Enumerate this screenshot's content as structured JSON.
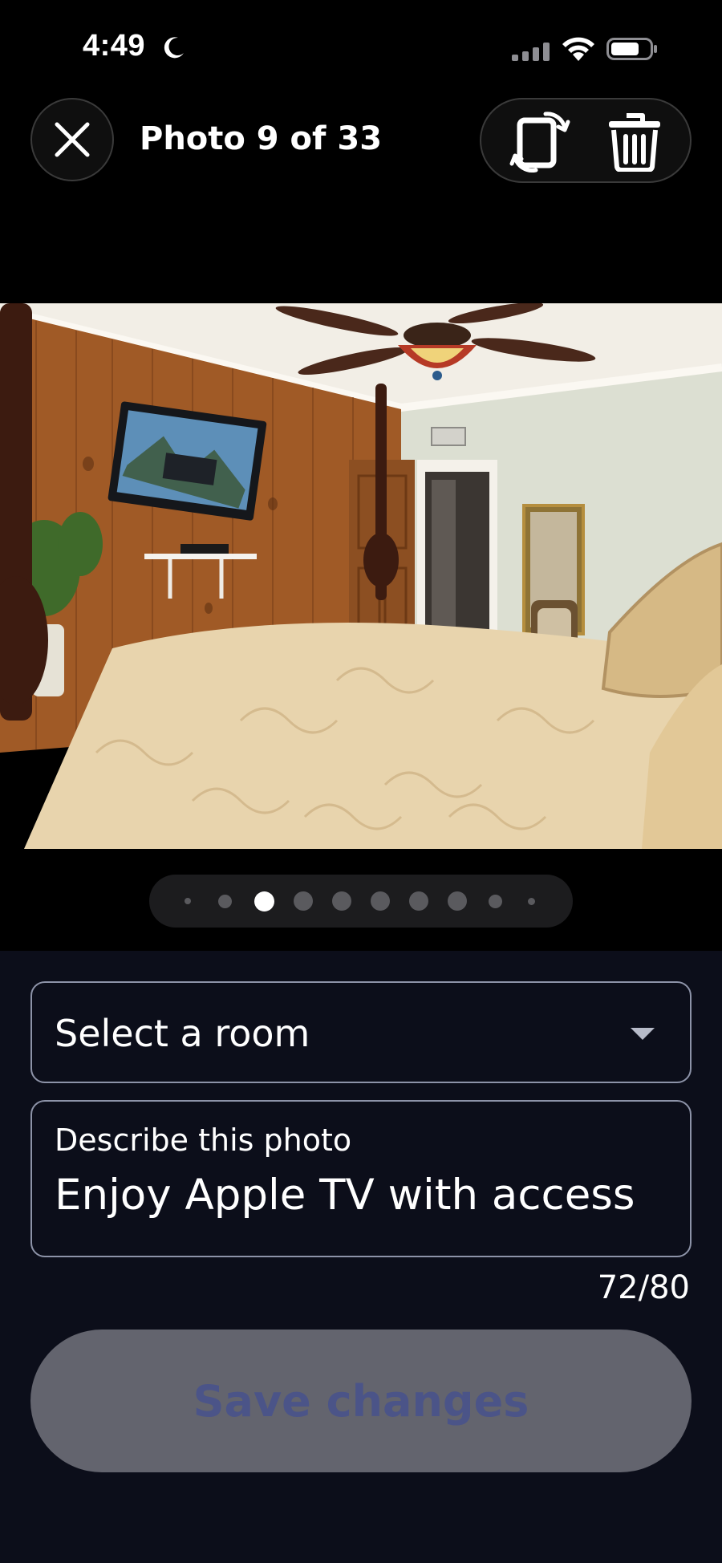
{
  "status_bar": {
    "time": "4:49",
    "icons": [
      "moon-icon",
      "signal-icon",
      "wifi-icon",
      "battery-icon"
    ]
  },
  "header": {
    "close_icon": "close-icon",
    "title": "Photo 9 of 33",
    "actions": [
      {
        "icon": "rotate-icon"
      },
      {
        "icon": "trash-icon"
      }
    ]
  },
  "photo": {
    "alt": ""
  },
  "pager": {
    "dot_count": 10,
    "active_index": 2
  },
  "form": {
    "room_select": {
      "value": "Select a room",
      "icon": "chevron-down-icon"
    },
    "description": {
      "label": "Describe this photo",
      "value": "Enjoy Apple TV with access",
      "counter": "72/80"
    },
    "save": {
      "label": "Save changes",
      "enabled": false
    }
  },
  "colors": {
    "background_top": "#000000",
    "background_form": "#0c0e1a",
    "field_border": "#8d93a8",
    "save_disabled_bg": "#63646e",
    "save_disabled_text": "#4b5488"
  }
}
